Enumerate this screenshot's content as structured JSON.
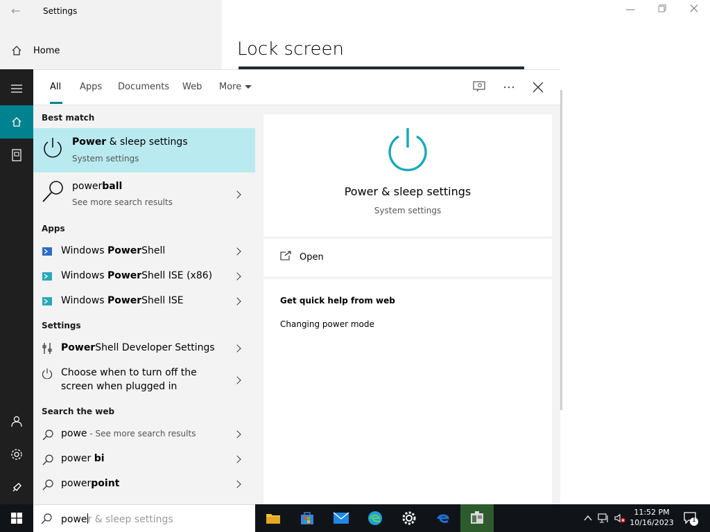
{
  "settings": {
    "title": "Settings",
    "home_label": "Home",
    "page_heading": "Lock screen"
  },
  "search": {
    "tabs": [
      {
        "label": "All"
      },
      {
        "label": "Apps"
      },
      {
        "label": "Documents"
      },
      {
        "label": "Web"
      },
      {
        "label": "More"
      }
    ],
    "best_match_head": "Best match",
    "best_match": {
      "bold": "Power",
      "rest": " & sleep settings",
      "sub": "System settings"
    },
    "web_result": {
      "plain": "power",
      "bold": "ball",
      "sub": "See more search results"
    },
    "apps_head": "Apps",
    "apps": [
      {
        "pre": "Windows ",
        "bold": "Power",
        "post": "Shell"
      },
      {
        "pre": "Windows ",
        "bold": "Power",
        "post": "Shell ISE (x86)"
      },
      {
        "pre": "Windows ",
        "bold": "Power",
        "post": "Shell ISE"
      }
    ],
    "settings_head": "Settings",
    "settings_items": [
      {
        "bold": "Power",
        "post": "Shell Developer Settings"
      },
      {
        "line1": "Choose when to turn off the",
        "line2": "screen when plugged in"
      }
    ],
    "web_head": "Search the web",
    "web_items": [
      {
        "plain": "powe",
        "suffix": " - See more search results"
      },
      {
        "plain": "power ",
        "bold": "bi"
      },
      {
        "plain": "power",
        "bold": "point"
      }
    ],
    "detail": {
      "title": "Power & sleep settings",
      "sub": "System settings",
      "open_label": "Open",
      "help_head": "Get quick help from web",
      "help_link": "Changing power mode"
    },
    "query_typed": "powe",
    "query_ghost": "r & sleep settings"
  },
  "taskbar": {
    "time": "11:52 PM",
    "date": "10/16/2023",
    "notification_count": "1"
  },
  "colors": {
    "accent": "#00838f",
    "selected_row": "#b9eaf0",
    "taskbar": "#101418"
  },
  "icons": [
    "search-icon",
    "home-icon",
    "power-icon",
    "powershell-icon",
    "gear-icon",
    "chevron-right-icon",
    "open-icon",
    "windows-icon"
  ]
}
